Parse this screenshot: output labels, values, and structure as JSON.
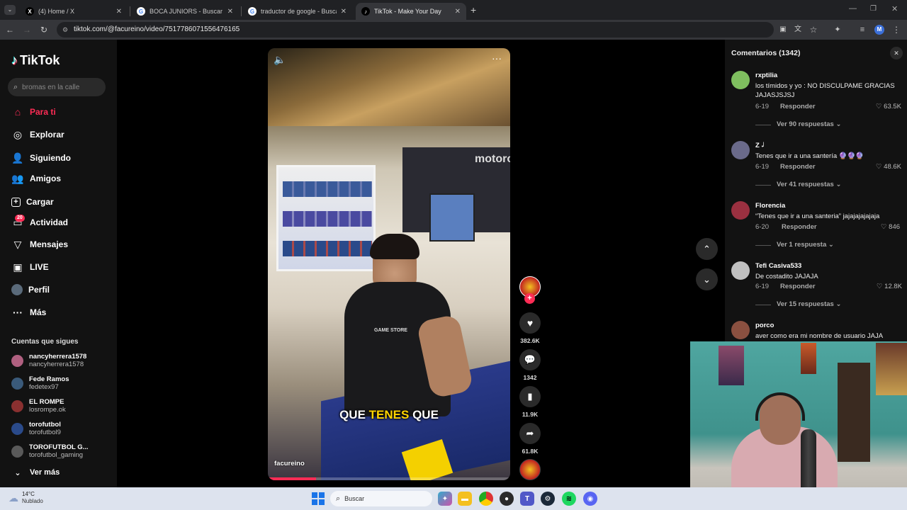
{
  "browser": {
    "tabs": [
      {
        "title": "(4) Home / X",
        "favicon": "X"
      },
      {
        "title": "BOCA JUNIORS - Buscar con Google",
        "favicon": "G"
      },
      {
        "title": "traductor de google - Buscar con Google",
        "favicon": "G"
      },
      {
        "title": "TikTok - Make Your Day",
        "favicon": "♪"
      }
    ],
    "url": "tiktok.com/@facureino/video/7517786071556476165",
    "profile_initial": "M"
  },
  "sidebar": {
    "logo": "TikTok",
    "search_placeholder": "bromas en la calle",
    "nav": [
      {
        "label": "Para ti",
        "icon": "home-icon",
        "active": true
      },
      {
        "label": "Explorar",
        "icon": "compass-icon"
      },
      {
        "label": "Siguiendo",
        "icon": "following-icon"
      },
      {
        "label": "Amigos",
        "icon": "friends-icon"
      },
      {
        "label": "Cargar",
        "icon": "upload-icon"
      },
      {
        "label": "Actividad",
        "icon": "activity-icon",
        "badge": "20"
      },
      {
        "label": "Mensajes",
        "icon": "messages-icon"
      },
      {
        "label": "LIVE",
        "icon": "live-icon"
      },
      {
        "label": "Perfil",
        "icon": "profile-icon"
      },
      {
        "label": "Más",
        "icon": "more-icon"
      }
    ],
    "following_header": "Cuentas que sigues",
    "following": [
      {
        "name": "nancyherrera1578",
        "handle": "nancyherrera1578",
        "color": "#b06080"
      },
      {
        "name": "Fede Ramos",
        "handle": "fedetex97",
        "color": "#3a5a7a"
      },
      {
        "name": "EL ROMPE",
        "handle": "losrompe.ok",
        "color": "#8a3030"
      },
      {
        "name": "torofutbol",
        "handle": "torofutbol9",
        "color": "#2a4a8a"
      },
      {
        "name": "TOROFUTBOL G...",
        "handle": "torofutbol_gaming",
        "color": "#5a5a5a"
      }
    ],
    "see_more": "Ver más"
  },
  "video": {
    "caption": [
      "QUE",
      "TENES",
      "QUE"
    ],
    "author_watermark": "facureino",
    "store_sign": "motorola",
    "shirt_text": "GAME STORE",
    "progress": 0.2
  },
  "actions": {
    "likes": "382.6K",
    "comments": "1342",
    "saves": "11.9K",
    "shares": "61.8K"
  },
  "comments_panel": {
    "title": "Comentarios (1342)",
    "items": [
      {
        "user": "rxptilia",
        "text": "los tímidos y yo : NO DISCULPAME GRACIAS JAJASJSJSJ",
        "date": "6-19",
        "reply": "Responder",
        "likes": "63.5K",
        "more": "Ver 90 respuestas",
        "color": "#7fbf5f"
      },
      {
        "user": "Z 𝆹𝅥",
        "text": "Tenes que ir a una santería 🔮🔮🔮",
        "date": "6-19",
        "reply": "Responder",
        "likes": "48.6K",
        "more": "Ver 41 respuestas",
        "color": "#6a6a8a"
      },
      {
        "user": "Florencia",
        "text": "“Tenes que ir a una santeria” jajajajajajaja",
        "date": "6-20",
        "reply": "Responder",
        "likes": "846",
        "more": "Ver 1 respuesta",
        "color": "#9a3040"
      },
      {
        "user": "Tefi Casiva533",
        "text": "De costadito JAJAJA",
        "date": "6-19",
        "reply": "Responder",
        "likes": "12.8K",
        "more": "Ver 15 respuestas",
        "color": "#c0c0c0"
      },
      {
        "user": "porco",
        "text": "aver como era mi nombre de usuario JAJA",
        "date": "",
        "reply": "",
        "likes": "",
        "more": "",
        "color": "#8a5040"
      }
    ]
  },
  "taskbar": {
    "weather_temp": "14°C",
    "weather_desc": "Nublado",
    "search": "Buscar"
  }
}
